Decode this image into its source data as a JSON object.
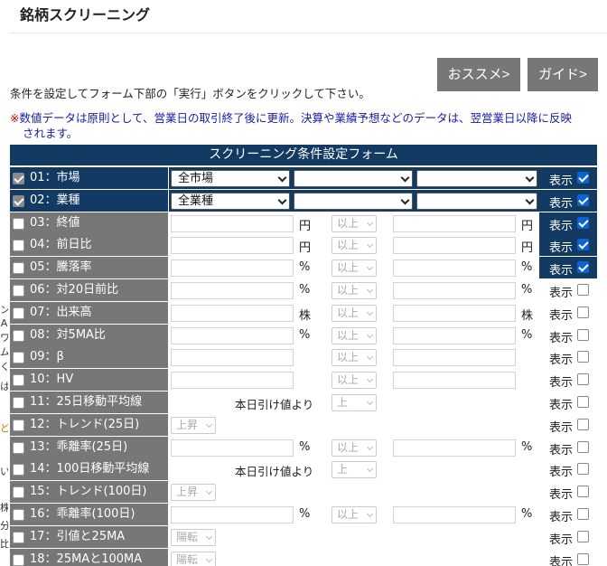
{
  "page": {
    "title": "銘柄スクリーニング",
    "buttons": {
      "recommend": "おススメ>",
      "guide": "ガイド>"
    },
    "instruction": "条件を設定してフォーム下部の「実行」ボタンをクリックして下さい。",
    "notice_mark": "※",
    "notice_line1": "数値データは原則として、営業日の取引終了後に更新。決算や業績予想などのデータは、翌営業日以降に反映",
    "notice_line2": "されます。"
  },
  "left_strip": [
    "ン",
    "A",
    "ワ",
    "ム",
    "く",
    "は",
    "ど",
    "い",
    "株",
    "分",
    "比"
  ],
  "form": {
    "header": "スクリーニング条件設定フォーム",
    "display_label": "表示",
    "rows": [
      {
        "label": "01：市場",
        "sel1": "全市場"
      },
      {
        "label": "02：業種",
        "sel1": "全業種"
      },
      {
        "label": "03：終値",
        "unit": "円",
        "cmp": "以上"
      },
      {
        "label": "04：前日比",
        "unit": "円",
        "cmp": "以上"
      },
      {
        "label": "05：騰落率",
        "unit": "%",
        "cmp": "以上"
      },
      {
        "label": "06：対20日前比",
        "unit": "%",
        "cmp": "以上"
      },
      {
        "label": "07：出来高",
        "unit": "株",
        "cmp": "以上"
      },
      {
        "label": "08：対5MA比",
        "unit": "%",
        "cmp": "以上"
      },
      {
        "label": "09：β",
        "cmp": "以上"
      },
      {
        "label": "10：HV",
        "cmp": "以上"
      },
      {
        "label": "11：25日移動平均線",
        "note": "本日引け値より",
        "cmp": "上"
      },
      {
        "label": "12：トレンド(25日)",
        "opt": "上昇"
      },
      {
        "label": "13：乖離率(25日)",
        "unit": "%",
        "cmp": "以上"
      },
      {
        "label": "14：100日移動平均線",
        "note": "本日引け値より",
        "cmp": "上"
      },
      {
        "label": "15：トレンド(100日)",
        "opt": "上昇"
      },
      {
        "label": "16：乖離率(100日)",
        "unit": "%",
        "cmp": "以上"
      },
      {
        "label": "17：引値と25MA",
        "opt": "陽転"
      },
      {
        "label": "18：25MAと100MA",
        "opt": "陽転"
      }
    ]
  }
}
